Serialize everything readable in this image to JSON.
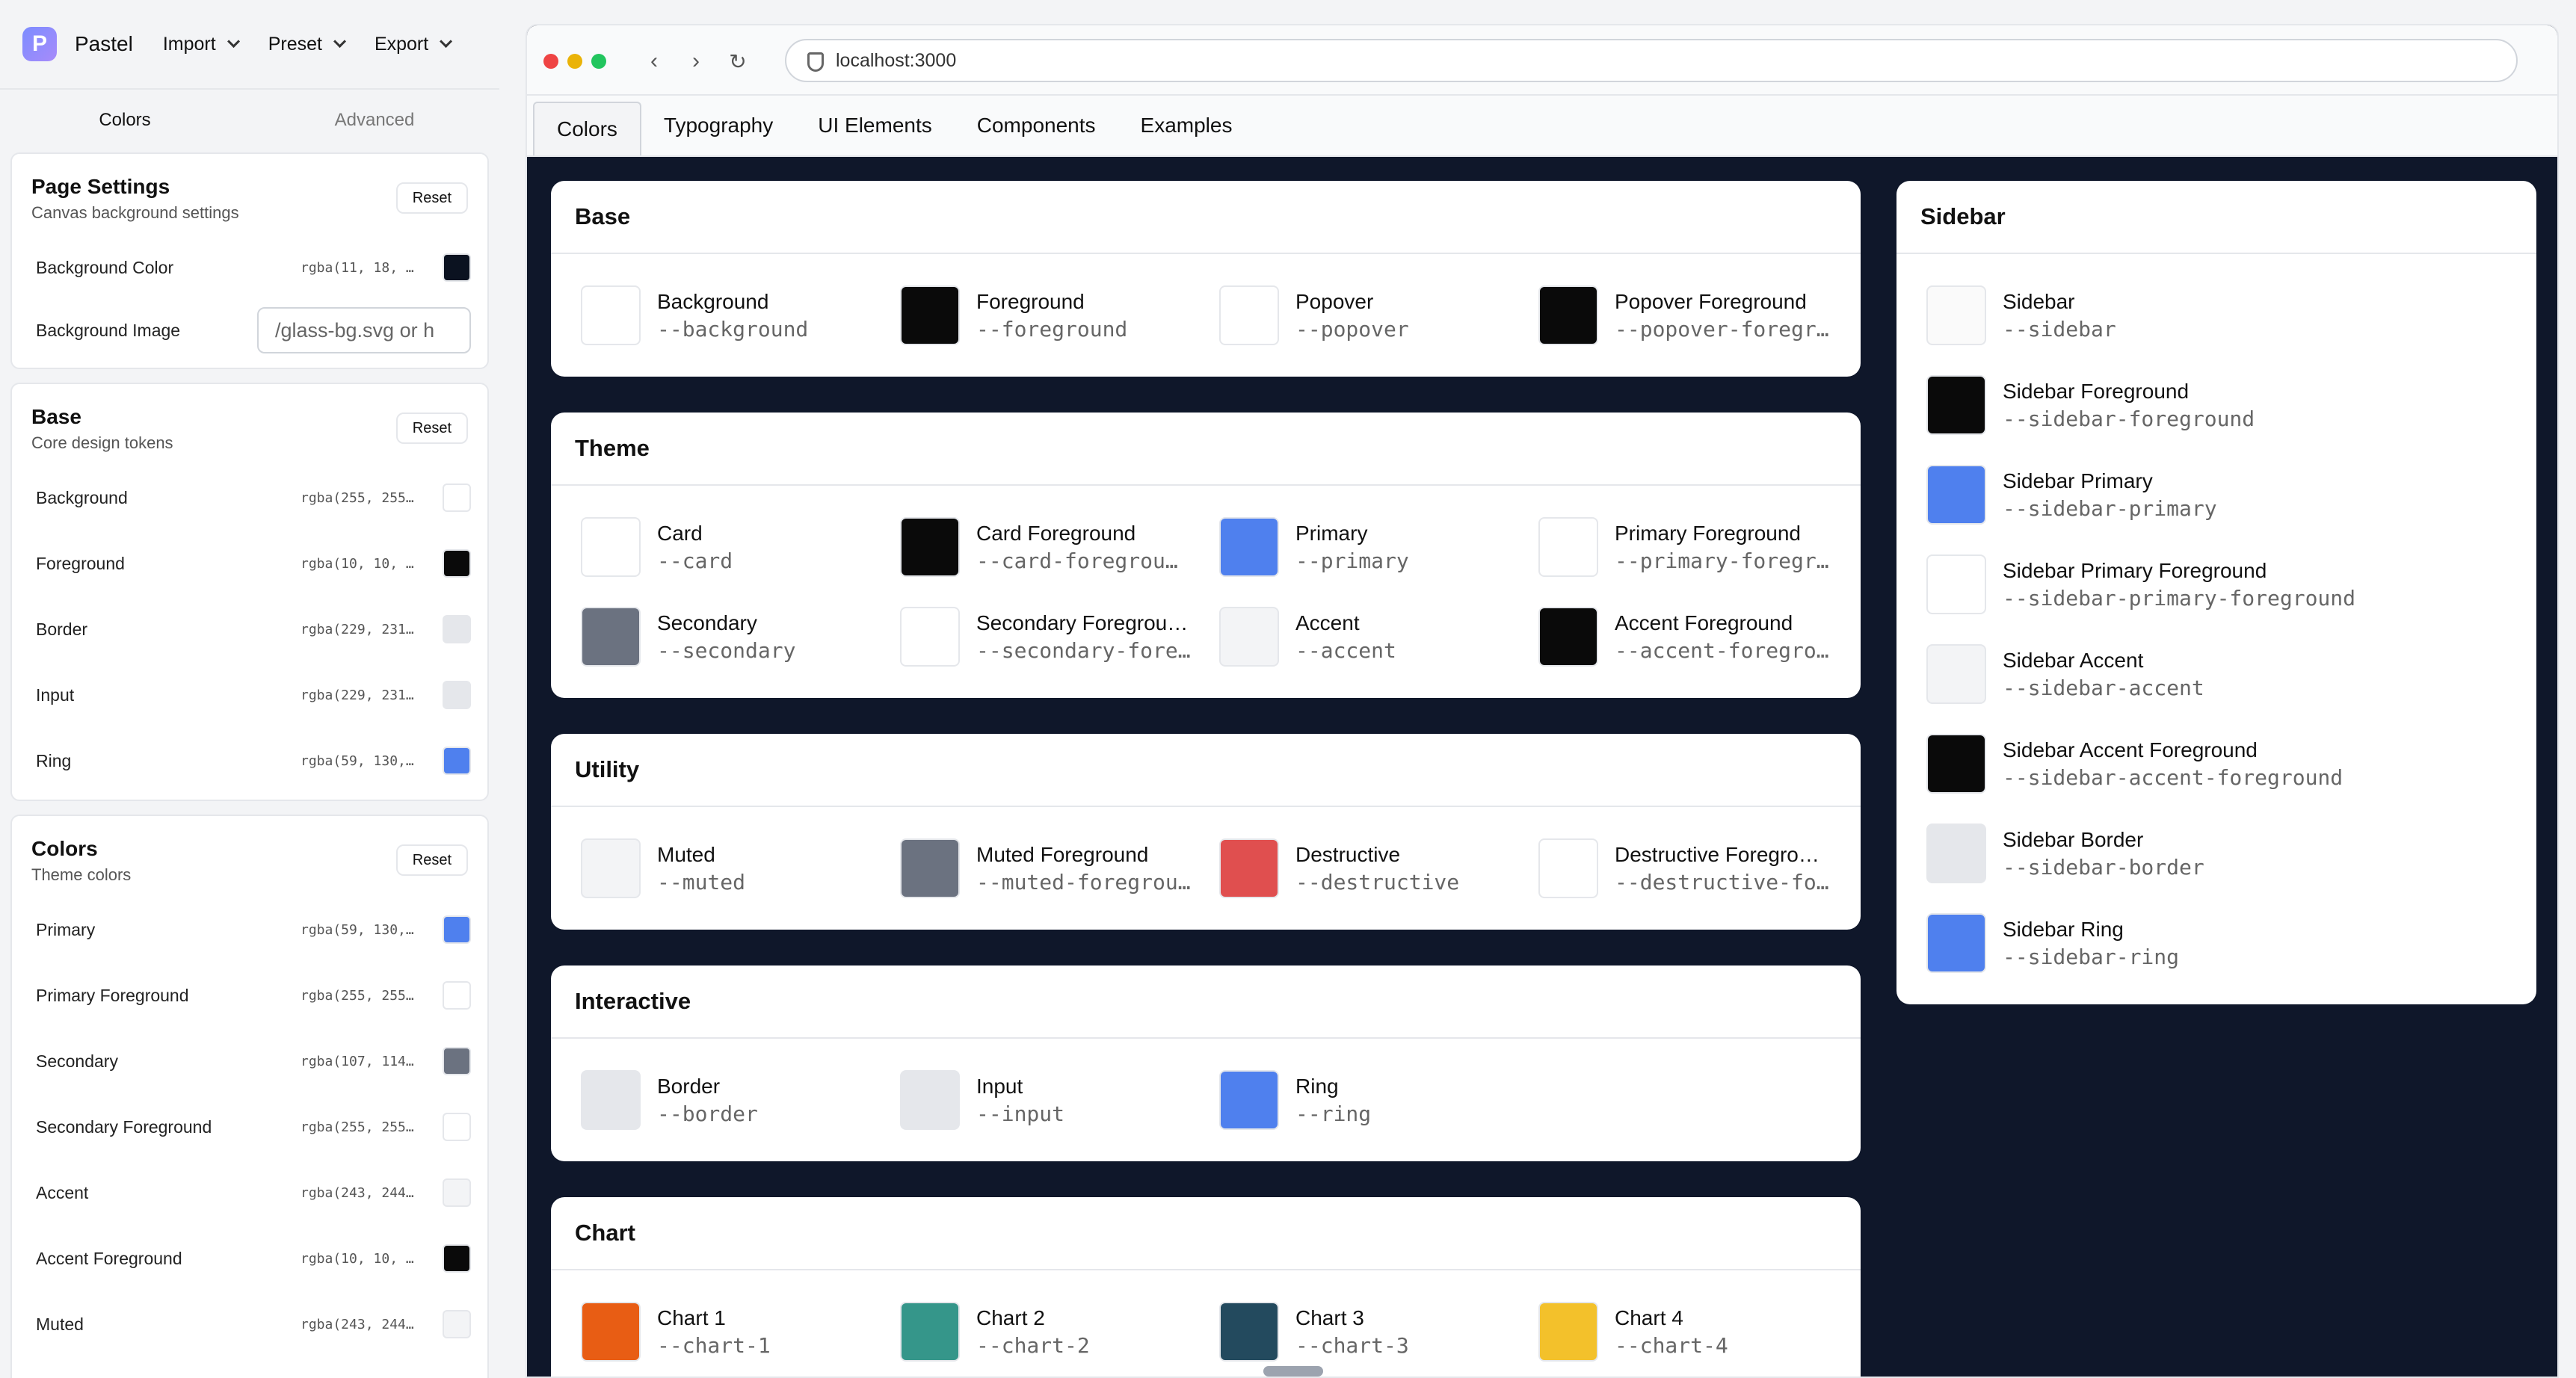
{
  "app": {
    "name": "Pastel",
    "logo_letter": "P",
    "menus": [
      {
        "label": "Import"
      },
      {
        "label": "Preset"
      },
      {
        "label": "Export"
      }
    ]
  },
  "left_tabs": [
    "Colors",
    "Advanced"
  ],
  "page_settings": {
    "title": "Page Settings",
    "subtitle": "Canvas background settings",
    "reset_label": "Reset",
    "bg_color_label": "Background Color",
    "bg_color_value": "rgba(11, 18, …",
    "bg_color_swatch": "#0b1220",
    "bg_image_label": "Background Image",
    "bg_image_placeholder": "/glass-bg.svg or h"
  },
  "base_group": {
    "title": "Base",
    "subtitle": "Core design tokens",
    "reset_label": "Reset",
    "rows": [
      {
        "label": "Background",
        "value": "rgba(255, 255…",
        "color": "#ffffff"
      },
      {
        "label": "Foreground",
        "value": "rgba(10, 10, …",
        "color": "#0a0a0a"
      },
      {
        "label": "Border",
        "value": "rgba(229, 231…",
        "color": "#e5e7eb"
      },
      {
        "label": "Input",
        "value": "rgba(229, 231…",
        "color": "#e5e7eb"
      },
      {
        "label": "Ring",
        "value": "rgba(59, 130,…",
        "color": "#4f80ee"
      }
    ]
  },
  "colors_group": {
    "title": "Colors",
    "subtitle": "Theme colors",
    "reset_label": "Reset",
    "rows": [
      {
        "label": "Primary",
        "value": "rgba(59, 130,…",
        "color": "#4f80ee"
      },
      {
        "label": "Primary Foreground",
        "value": "rgba(255, 255…",
        "color": "#ffffff"
      },
      {
        "label": "Secondary",
        "value": "rgba(107, 114…",
        "color": "#6b7280"
      },
      {
        "label": "Secondary Foreground",
        "value": "rgba(255, 255…",
        "color": "#ffffff"
      },
      {
        "label": "Accent",
        "value": "rgba(243, 244…",
        "color": "#f3f4f6"
      },
      {
        "label": "Accent Foreground",
        "value": "rgba(10, 10, …",
        "color": "#0a0a0a"
      },
      {
        "label": "Muted",
        "value": "rgba(243, 244…",
        "color": "#f3f4f6"
      }
    ]
  },
  "browser": {
    "url": "localhost:3000",
    "tabs": [
      "Colors",
      "Typography",
      "UI Elements",
      "Components",
      "Examples"
    ],
    "active_tab": "Colors"
  },
  "preview": {
    "base": {
      "title": "Base",
      "tokens": [
        {
          "name": "Background",
          "var": "--background",
          "color": "#ffffff"
        },
        {
          "name": "Foreground",
          "var": "--foreground",
          "color": "#0a0a0a"
        },
        {
          "name": "Popover",
          "var": "--popover",
          "color": "#ffffff"
        },
        {
          "name": "Popover Foreground",
          "var": "--popover-foregr…",
          "color": "#0a0a0a"
        }
      ]
    },
    "theme": {
      "title": "Theme",
      "tokens": [
        {
          "name": "Card",
          "var": "--card",
          "color": "#ffffff"
        },
        {
          "name": "Card Foreground",
          "var": "--card-foregrou…",
          "color": "#0a0a0a"
        },
        {
          "name": "Primary",
          "var": "--primary",
          "color": "#4f80ee"
        },
        {
          "name": "Primary Foreground",
          "var": "--primary-foregr…",
          "color": "#ffffff"
        },
        {
          "name": "Secondary",
          "var": "--secondary",
          "color": "#6b7280"
        },
        {
          "name": "Secondary Foregrou…",
          "var": "--secondary-fore…",
          "color": "#ffffff"
        },
        {
          "name": "Accent",
          "var": "--accent",
          "color": "#f3f4f6"
        },
        {
          "name": "Accent Foreground",
          "var": "--accent-foregro…",
          "color": "#0a0a0a"
        }
      ]
    },
    "utility": {
      "title": "Utility",
      "tokens": [
        {
          "name": "Muted",
          "var": "--muted",
          "color": "#f3f4f6"
        },
        {
          "name": "Muted Foreground",
          "var": "--muted-foregrou…",
          "color": "#6b7280"
        },
        {
          "name": "Destructive",
          "var": "--destructive",
          "color": "#e04f4f"
        },
        {
          "name": "Destructive Foregro…",
          "var": "--destructive-fo…",
          "color": "#ffffff"
        }
      ]
    },
    "interactive": {
      "title": "Interactive",
      "tokens": [
        {
          "name": "Border",
          "var": "--border",
          "color": "#e5e7eb"
        },
        {
          "name": "Input",
          "var": "--input",
          "color": "#e5e7eb"
        },
        {
          "name": "Ring",
          "var": "--ring",
          "color": "#4f80ee"
        }
      ]
    },
    "chart": {
      "title": "Chart",
      "tokens": [
        {
          "name": "Chart 1",
          "var": "--chart-1",
          "color": "#e85d14"
        },
        {
          "name": "Chart 2",
          "var": "--chart-2",
          "color": "#35968a"
        },
        {
          "name": "Chart 3",
          "var": "--chart-3",
          "color": "#234a5e"
        },
        {
          "name": "Chart 4",
          "var": "--chart-4",
          "color": "#f3c12b"
        }
      ]
    },
    "sidebar": {
      "title": "Sidebar",
      "tokens": [
        {
          "name": "Sidebar",
          "var": "--sidebar",
          "color": "#fafafa"
        },
        {
          "name": "Sidebar Foreground",
          "var": "--sidebar-foreground",
          "color": "#0a0a0a"
        },
        {
          "name": "Sidebar Primary",
          "var": "--sidebar-primary",
          "color": "#4f80ee"
        },
        {
          "name": "Sidebar Primary Foreground",
          "var": "--sidebar-primary-foreground",
          "color": "#ffffff"
        },
        {
          "name": "Sidebar Accent",
          "var": "--sidebar-accent",
          "color": "#f3f4f6"
        },
        {
          "name": "Sidebar Accent Foreground",
          "var": "--sidebar-accent-foreground",
          "color": "#0a0a0a"
        },
        {
          "name": "Sidebar Border",
          "var": "--sidebar-border",
          "color": "#e5e7eb"
        },
        {
          "name": "Sidebar Ring",
          "var": "--sidebar-ring",
          "color": "#4f80ee"
        }
      ]
    }
  }
}
